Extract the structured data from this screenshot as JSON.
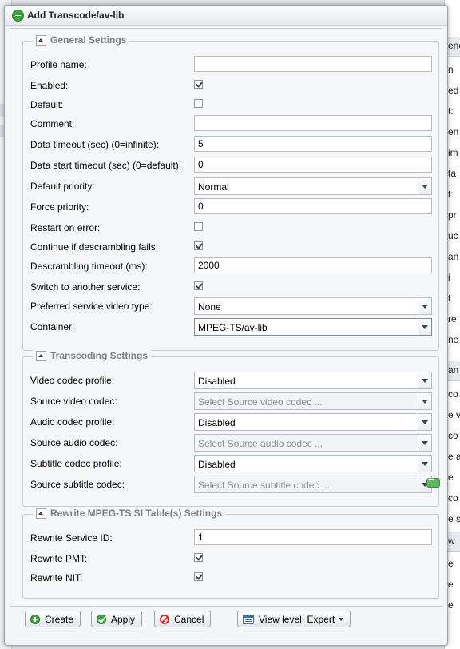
{
  "dialog": {
    "title": "Add Transcode/av-lib"
  },
  "background": {
    "right_fragments": [
      "ene",
      "n",
      "ed",
      "t:",
      "en",
      "im",
      "ta",
      "t:",
      "pr",
      "uc",
      "an",
      "i",
      "t",
      "re",
      "ne",
      "an",
      "co",
      "e v",
      "co",
      "e a",
      "e",
      "co",
      "e s",
      "w",
      "e",
      "e",
      "e"
    ]
  },
  "general": {
    "legend": "General Settings",
    "profile_name": {
      "label": "Profile name:",
      "value": ""
    },
    "enabled": {
      "label": "Enabled:",
      "checked": true
    },
    "default": {
      "label": "Default:",
      "checked": false
    },
    "comment": {
      "label": "Comment:",
      "value": ""
    },
    "data_timeout": {
      "label": "Data timeout (sec) (0=infinite):",
      "value": "5"
    },
    "data_start_timeout": {
      "label": "Data start timeout (sec) (0=default):",
      "value": "0"
    },
    "default_priority": {
      "label": "Default priority:",
      "value": "Normal"
    },
    "force_priority": {
      "label": "Force priority:",
      "value": "0"
    },
    "restart_on_error": {
      "label": "Restart on error:",
      "checked": false
    },
    "continue_descrambling": {
      "label": "Continue if descrambling fails:",
      "checked": true
    },
    "descrambling_timeout": {
      "label": "Descrambling timeout (ms):",
      "value": "2000"
    },
    "switch_service": {
      "label": "Switch to another service:",
      "checked": true
    },
    "preferred_video_type": {
      "label": "Preferred service video type:",
      "value": "None"
    },
    "container": {
      "label": "Container:",
      "value": "MPEG-TS/av-lib"
    }
  },
  "transcoding": {
    "legend": "Transcoding Settings",
    "video_codec_profile": {
      "label": "Video codec profile:",
      "value": "Disabled"
    },
    "source_video_codec": {
      "label": "Source video codec:",
      "placeholder": "Select Source video codec ..."
    },
    "audio_codec_profile": {
      "label": "Audio codec profile:",
      "value": "Disabled"
    },
    "source_audio_codec": {
      "label": "Source audio codec:",
      "placeholder": "Select Source audio codec ..."
    },
    "subtitle_codec_profile": {
      "label": "Subtitle codec profile:",
      "value": "Disabled"
    },
    "source_subtitle_codec": {
      "label": "Source subtitle codec:",
      "placeholder": "Select Source subtitle codec ..."
    }
  },
  "rewrite": {
    "legend": "Rewrite MPEG-TS SI Table(s) Settings",
    "service_id": {
      "label": "Rewrite Service ID:",
      "value": "1"
    },
    "pmt": {
      "label": "Rewrite PMT:",
      "checked": true
    },
    "nit": {
      "label": "Rewrite NIT:",
      "checked": true
    }
  },
  "footer": {
    "create": "Create",
    "apply": "Apply",
    "cancel": "Cancel",
    "view_level": "View level: Expert"
  }
}
